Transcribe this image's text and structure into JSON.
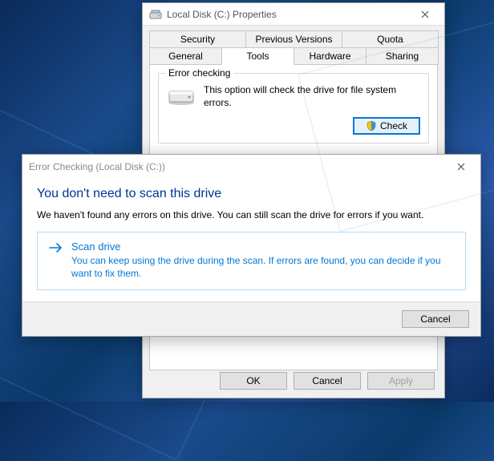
{
  "props": {
    "title": "Local Disk (C:) Properties",
    "tabs_row1": [
      "Security",
      "Previous Versions",
      "Quota"
    ],
    "tabs_row2": [
      "General",
      "Tools",
      "Hardware",
      "Sharing"
    ],
    "active_tab": "Tools",
    "error_checking": {
      "group_label": "Error checking",
      "description": "This option will check the drive for file system errors.",
      "button_label": "Check"
    },
    "buttons": {
      "ok": "OK",
      "cancel": "Cancel",
      "apply": "Apply"
    }
  },
  "errchk": {
    "title": "Error Checking (Local Disk (C:))",
    "heading": "You don't need to scan this drive",
    "message": "We haven't found any errors on this drive. You can still scan the drive for errors if you want.",
    "action": {
      "title": "Scan drive",
      "description": "You can keep using the drive during the scan. If errors are found, you can decide if you want to fix them."
    },
    "cancel": "Cancel"
  }
}
